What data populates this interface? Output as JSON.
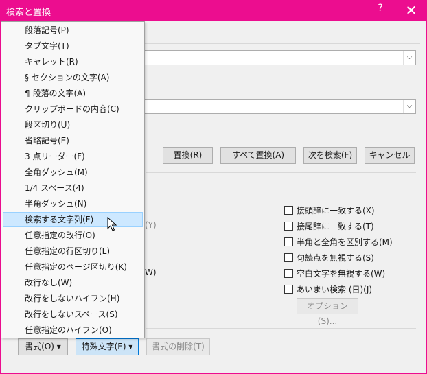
{
  "window": {
    "title": "検索と置換",
    "help_glyph": "?",
    "close_glyph": "✕"
  },
  "buttons": {
    "replace": "置換(R)",
    "replace_all": "すべて置換(A)",
    "find_next": "次を検索(F)",
    "cancel": "キャンセル",
    "format": "書式(O) ▾",
    "special": "特殊文字(E) ▾",
    "clear_format": "書式の削除(T)",
    "options": "オプション(S)..."
  },
  "clipped": {
    "text_y": "(Y)",
    "text_w": "W)"
  },
  "options": [
    {
      "label": "接頭辞に一致する(X)",
      "checked": false
    },
    {
      "label": "接尾辞に一致する(T)",
      "checked": false
    },
    {
      "label": "半角と全角を区別する(M)",
      "checked": false
    },
    {
      "label": "句読点を無視する(S)",
      "checked": false
    },
    {
      "label": "空白文字を無視する(W)",
      "checked": false
    },
    {
      "label": "あいまい検索 (日)(J)",
      "checked": false
    }
  ],
  "special_menu": {
    "items": [
      "段落記号(P)",
      "タブ文字(T)",
      "キャレット(R)",
      "§ セクションの文字(A)",
      "¶ 段落の文字(A)",
      "クリップボードの内容(C)",
      "段区切り(U)",
      "省略記号(E)",
      "3 点リーダー(F)",
      "全角ダッシュ(M)",
      "1/4 スペース(4)",
      "半角ダッシュ(N)",
      "検索する文字列(F)",
      "任意指定の改行(O)",
      "任意指定の行区切り(L)",
      "任意指定のページ区切り(K)",
      "改行なし(W)",
      "改行をしないハイフン(H)",
      "改行をしないスペース(S)",
      "任意指定のハイフン(O)"
    ],
    "highlighted_index": 12
  },
  "colors": {
    "titlebar": "#ec0d8f",
    "menu_highlight": "#cde8ff"
  }
}
